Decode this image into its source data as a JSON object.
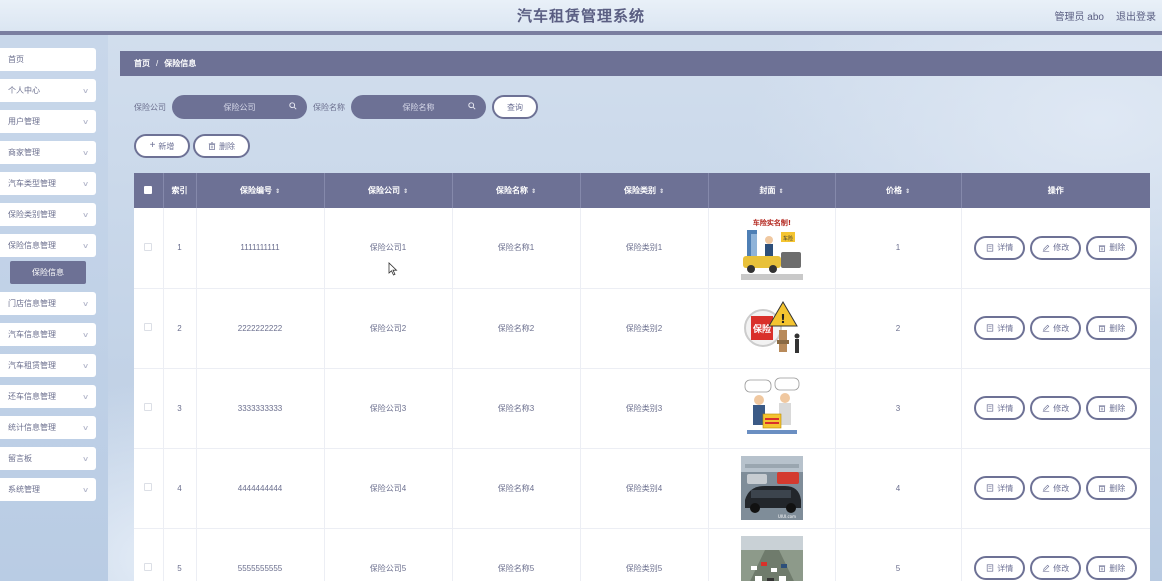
{
  "header": {
    "title": "汽车租赁管理系统",
    "user": "管理员 abo",
    "logout": "退出登录"
  },
  "sidebar": {
    "items": [
      {
        "label": "首页",
        "expandable": false
      },
      {
        "label": "个人中心",
        "expandable": true
      },
      {
        "label": "用户管理",
        "expandable": true
      },
      {
        "label": "商家管理",
        "expandable": true
      },
      {
        "label": "汽车类型管理",
        "expandable": true
      },
      {
        "label": "保险类别管理",
        "expandable": true
      },
      {
        "label": "保险信息管理",
        "expandable": true
      },
      {
        "label": "门店信息管理",
        "expandable": true
      },
      {
        "label": "汽车信息管理",
        "expandable": true
      },
      {
        "label": "汽车租赁管理",
        "expandable": true
      },
      {
        "label": "还车信息管理",
        "expandable": true
      },
      {
        "label": "统计信息管理",
        "expandable": true
      },
      {
        "label": "留言板",
        "expandable": true
      },
      {
        "label": "系统管理",
        "expandable": true
      }
    ],
    "active_sub": "保险信息"
  },
  "breadcrumb": {
    "home": "首页",
    "separator": "/",
    "current": "保险信息"
  },
  "search": {
    "company_label": "保险公司",
    "company_placeholder": "保险公司",
    "name_label": "保险名称",
    "name_placeholder": "保险名称",
    "query_button": "查询"
  },
  "actions": {
    "add": "新增",
    "delete": "删除"
  },
  "table": {
    "columns": {
      "index": "索引",
      "code": "保险编号",
      "company": "保险公司",
      "name": "保险名称",
      "category": "保险类别",
      "cover": "封面",
      "price": "价格",
      "ops": "操作"
    },
    "rows": [
      {
        "index": "1",
        "code": "1111111111",
        "company": "保险公司1",
        "name": "保险名称1",
        "category": "保险类别1",
        "price": "1"
      },
      {
        "index": "2",
        "code": "2222222222",
        "company": "保险公司2",
        "name": "保险名称2",
        "category": "保险类别2",
        "price": "2"
      },
      {
        "index": "3",
        "code": "3333333333",
        "company": "保险公司3",
        "name": "保险名称3",
        "category": "保险类别3",
        "price": "3"
      },
      {
        "index": "4",
        "code": "4444444444",
        "company": "保险公司4",
        "name": "保险名称4",
        "category": "保险类别4",
        "price": "4"
      },
      {
        "index": "5",
        "code": "5555555555",
        "company": "保险公司5",
        "name": "保险名称5",
        "category": "保险类别5",
        "price": "5"
      }
    ],
    "row_ops": {
      "detail": "详情",
      "edit": "修改",
      "delete": "删除"
    },
    "cover_texts": {
      "row1_banner": "车险实名制!",
      "row1_sign": "车险",
      "row2_sign": "保险",
      "row4_watermark": "UIUI.com"
    }
  },
  "colors": {
    "accent": "#6d7195",
    "header_bg": "#e3ebf5",
    "sidebar_bg": "#c1d2e8"
  }
}
